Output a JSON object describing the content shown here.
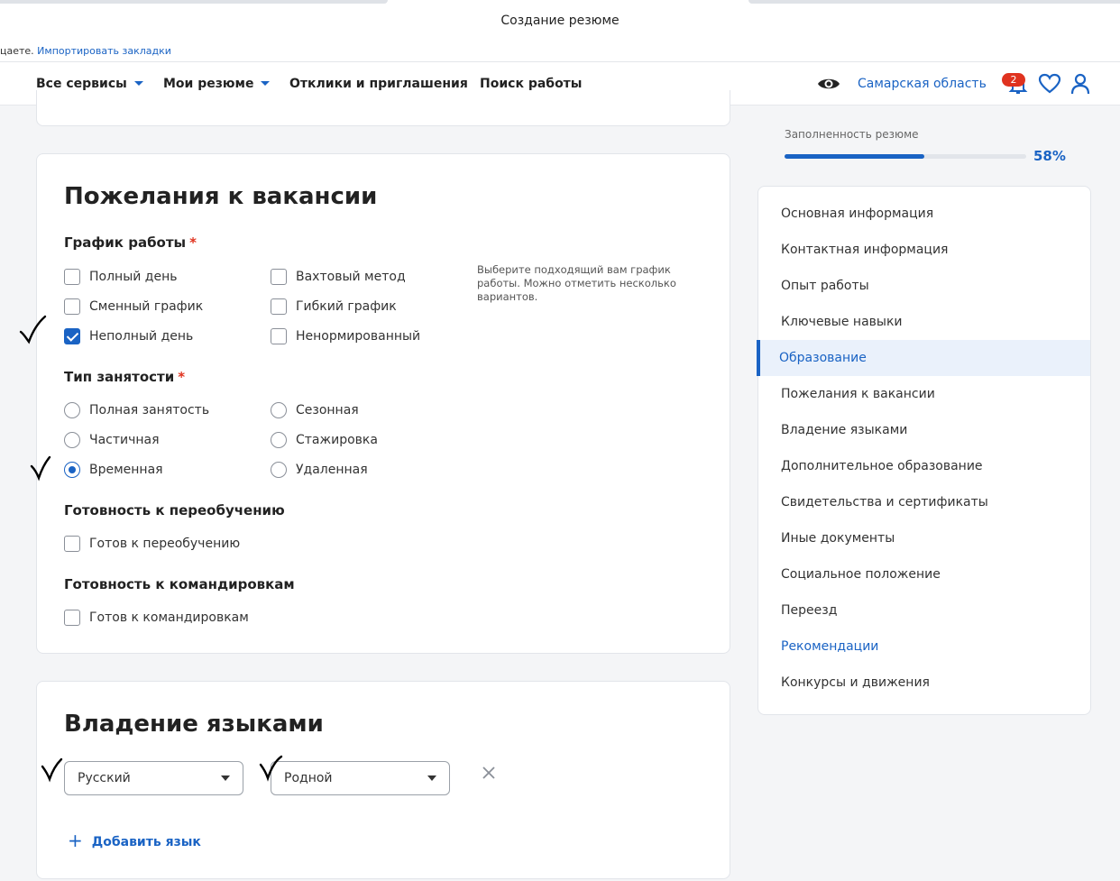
{
  "browser": {
    "window_title": "Создание резюме",
    "bookmarks_text": "цаете.",
    "bookmarks_link": "Импортировать закладки"
  },
  "header": {
    "nav": [
      {
        "label": "Все сервисы",
        "dropdown": true
      },
      {
        "label": "Мои резюме",
        "dropdown": true
      },
      {
        "label": "Отклики и приглашения",
        "dropdown": false
      },
      {
        "label": "Поиск работы",
        "dropdown": false
      }
    ],
    "region": "Самарская область",
    "notifications_count": "2"
  },
  "wishes": {
    "title": "Пожелания к вакансии",
    "schedule": {
      "label": "График работы",
      "hint": "Выберите подходящий вам график работы. Можно отметить несколько вариантов.",
      "options": [
        {
          "label": "Полный день",
          "checked": false
        },
        {
          "label": "Сменный график",
          "checked": false
        },
        {
          "label": "Неполный день",
          "checked": true
        },
        {
          "label": "Вахтовый метод",
          "checked": false
        },
        {
          "label": "Гибкий график",
          "checked": false
        },
        {
          "label": "Ненормированный",
          "checked": false
        }
      ]
    },
    "employment": {
      "label": "Тип занятости",
      "options": [
        {
          "label": "Полная занятость",
          "selected": false
        },
        {
          "label": "Частичная",
          "selected": false
        },
        {
          "label": "Временная",
          "selected": true
        },
        {
          "label": "Сезонная",
          "selected": false
        },
        {
          "label": "Стажировка",
          "selected": false
        },
        {
          "label": "Удаленная",
          "selected": false
        }
      ]
    },
    "retraining": {
      "label": "Готовность к переобучению",
      "option": "Готов к переобучению",
      "checked": false
    },
    "business_trips": {
      "label": "Готовность к командировкам",
      "option": "Готов к командировкам",
      "checked": false
    }
  },
  "languages": {
    "title": "Владение языками",
    "language_value": "Русский",
    "level_value": "Родной",
    "add_label": "Добавить язык"
  },
  "progress": {
    "label": "Заполненность резюме",
    "value": 0.58,
    "percent_text": "58%"
  },
  "side_nav": {
    "items": [
      {
        "label": "Основная информация",
        "state": "normal"
      },
      {
        "label": "Контактная информация",
        "state": "normal"
      },
      {
        "label": "Опыт работы",
        "state": "normal"
      },
      {
        "label": "Ключевые навыки",
        "state": "normal"
      },
      {
        "label": "Образование",
        "state": "active"
      },
      {
        "label": "Пожелания к вакансии",
        "state": "normal"
      },
      {
        "label": "Владение языками",
        "state": "normal"
      },
      {
        "label": "Дополнительное образование",
        "state": "normal"
      },
      {
        "label": "Свидетельства и сертификаты",
        "state": "normal"
      },
      {
        "label": "Иные документы",
        "state": "normal"
      },
      {
        "label": "Социальное положение",
        "state": "normal"
      },
      {
        "label": "Переезд",
        "state": "normal"
      },
      {
        "label": "Рекомендации",
        "state": "link"
      },
      {
        "label": "Конкурсы и движения",
        "state": "normal"
      }
    ]
  },
  "colors": {
    "accent": "#1a63c4",
    "required": "#e0331f",
    "badge": "#e0331f"
  }
}
